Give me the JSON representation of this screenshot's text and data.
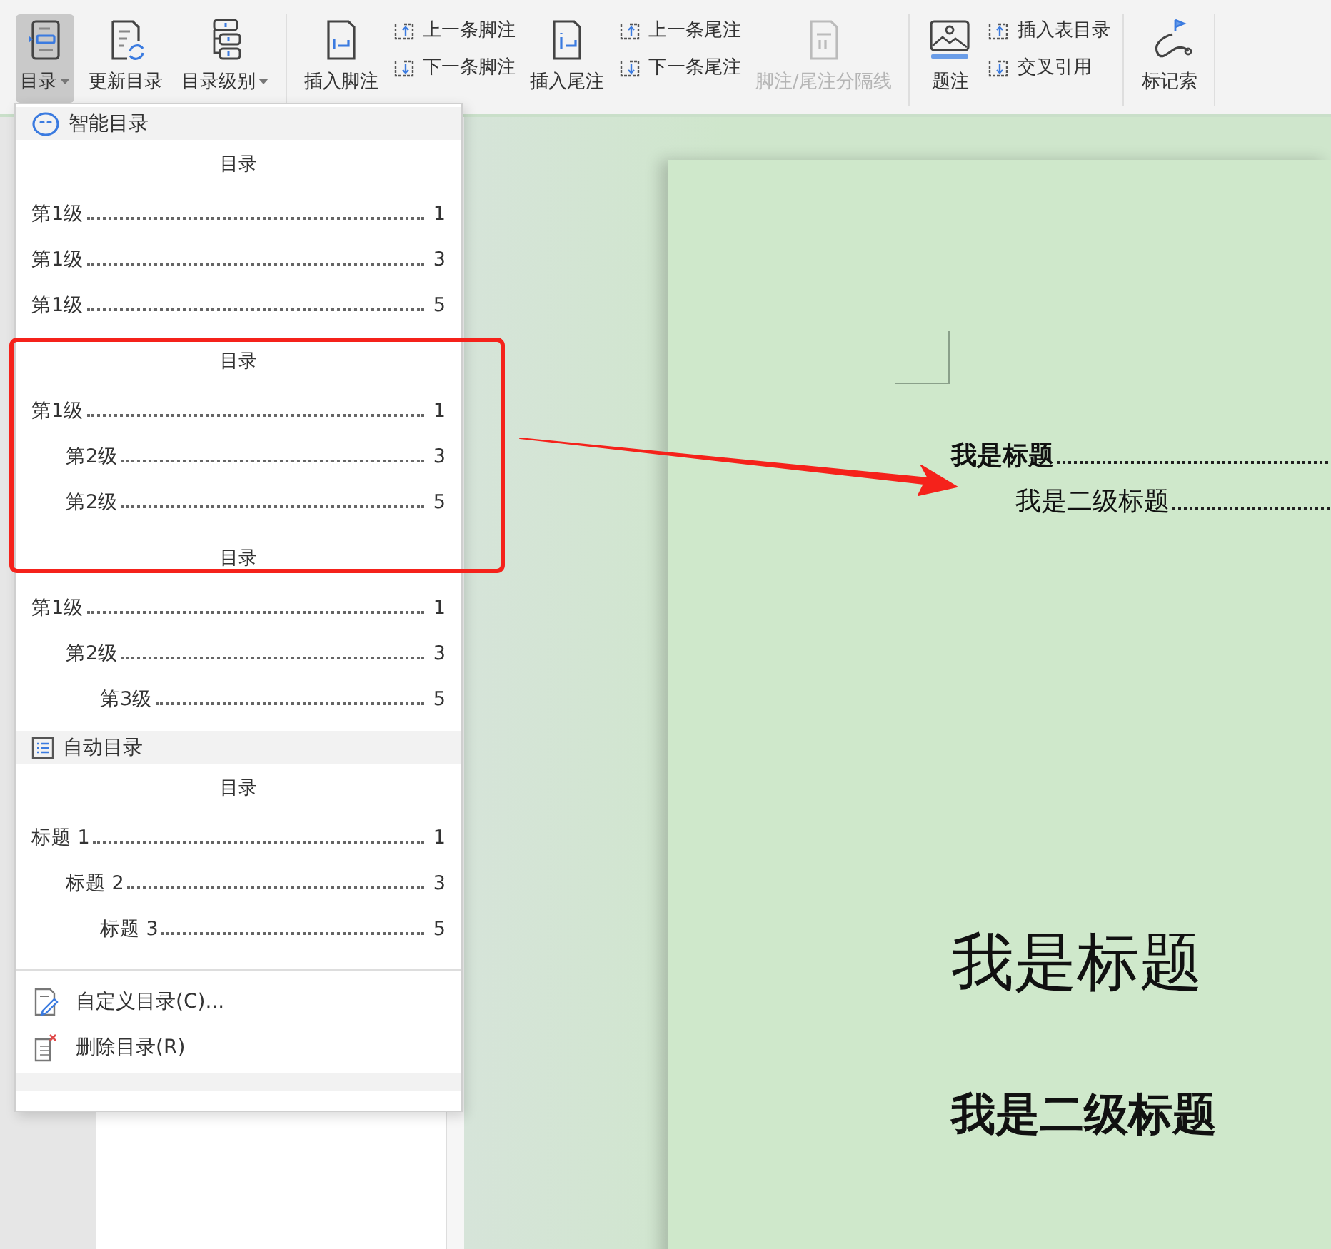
{
  "toolbar": {
    "groups": [
      {
        "items": [
          {
            "kind": "large",
            "label": "目录",
            "dropdown": true,
            "pressed": true,
            "disabled": false
          },
          {
            "kind": "large",
            "label": "更新目录",
            "dropdown": false,
            "pressed": false,
            "disabled": false
          },
          {
            "kind": "large",
            "label": "目录级别",
            "dropdown": true,
            "pressed": false,
            "disabled": false
          }
        ]
      },
      {
        "items": [
          {
            "kind": "large",
            "label": "插入脚注",
            "dropdown": false,
            "pressed": false,
            "disabled": false
          },
          {
            "kind": "stack",
            "labels": [
              "上一条脚注",
              "下一条脚注"
            ]
          },
          {
            "kind": "large",
            "label": "插入尾注",
            "dropdown": false,
            "pressed": false,
            "disabled": false
          },
          {
            "kind": "stack",
            "labels": [
              "上一条尾注",
              "下一条尾注"
            ]
          },
          {
            "kind": "large",
            "label": "脚注/尾注分隔线",
            "dropdown": false,
            "pressed": false,
            "disabled": true
          }
        ]
      },
      {
        "items": [
          {
            "kind": "large",
            "label": "题注",
            "dropdown": false,
            "pressed": false,
            "disabled": false
          },
          {
            "kind": "stack",
            "labels": [
              "插入表目录",
              "交叉引用"
            ]
          }
        ]
      },
      {
        "items": [
          {
            "kind": "large",
            "label": "标记索",
            "dropdown": false,
            "pressed": false,
            "disabled": false
          }
        ]
      }
    ]
  },
  "toc_menu": {
    "sections": [
      {
        "kind": "header",
        "label": "智能目录"
      },
      {
        "kind": "preview",
        "title": "目录",
        "entries": [
          {
            "label": "第1级",
            "page": "1"
          },
          {
            "label": "第1级",
            "page": "3"
          },
          {
            "label": "第1级",
            "page": "5"
          }
        ]
      },
      {
        "kind": "preview",
        "title": "目录",
        "entries": [
          {
            "label": "第1级",
            "page": "1",
            "children": [
              {
                "label": "第2级",
                "page": "3"
              },
              {
                "label": "第2级",
                "page": "5"
              }
            ]
          }
        ]
      },
      {
        "kind": "preview",
        "title": "目录",
        "entries": [
          {
            "label": "第1级",
            "page": "1",
            "children": [
              {
                "label": "第2级",
                "page": "3",
                "children": [
                  {
                    "label": "第3级",
                    "page": "5"
                  }
                ]
              }
            ]
          }
        ]
      },
      {
        "kind": "header",
        "label": "自动目录"
      },
      {
        "kind": "preview",
        "title": "目录",
        "entries": [
          {
            "label": "标题 1",
            "page": "1",
            "children": [
              {
                "label": "标题 2",
                "page": "3",
                "children": [
                  {
                    "label": "标题 3",
                    "page": "5"
                  }
                ]
              }
            ]
          }
        ]
      },
      {
        "kind": "divider"
      },
      {
        "kind": "action",
        "label": "自定义目录(C)..."
      },
      {
        "kind": "action",
        "label": "删除目录(R)"
      }
    ]
  },
  "document": {
    "toc_lines": [
      {
        "label": "我是标题",
        "bold": true
      },
      {
        "label": "我是二级标题",
        "bold": false
      }
    ],
    "headings": [
      {
        "kind": "h1",
        "text": "我是标题"
      },
      {
        "kind": "h2",
        "text": "我是二级标题"
      }
    ]
  }
}
